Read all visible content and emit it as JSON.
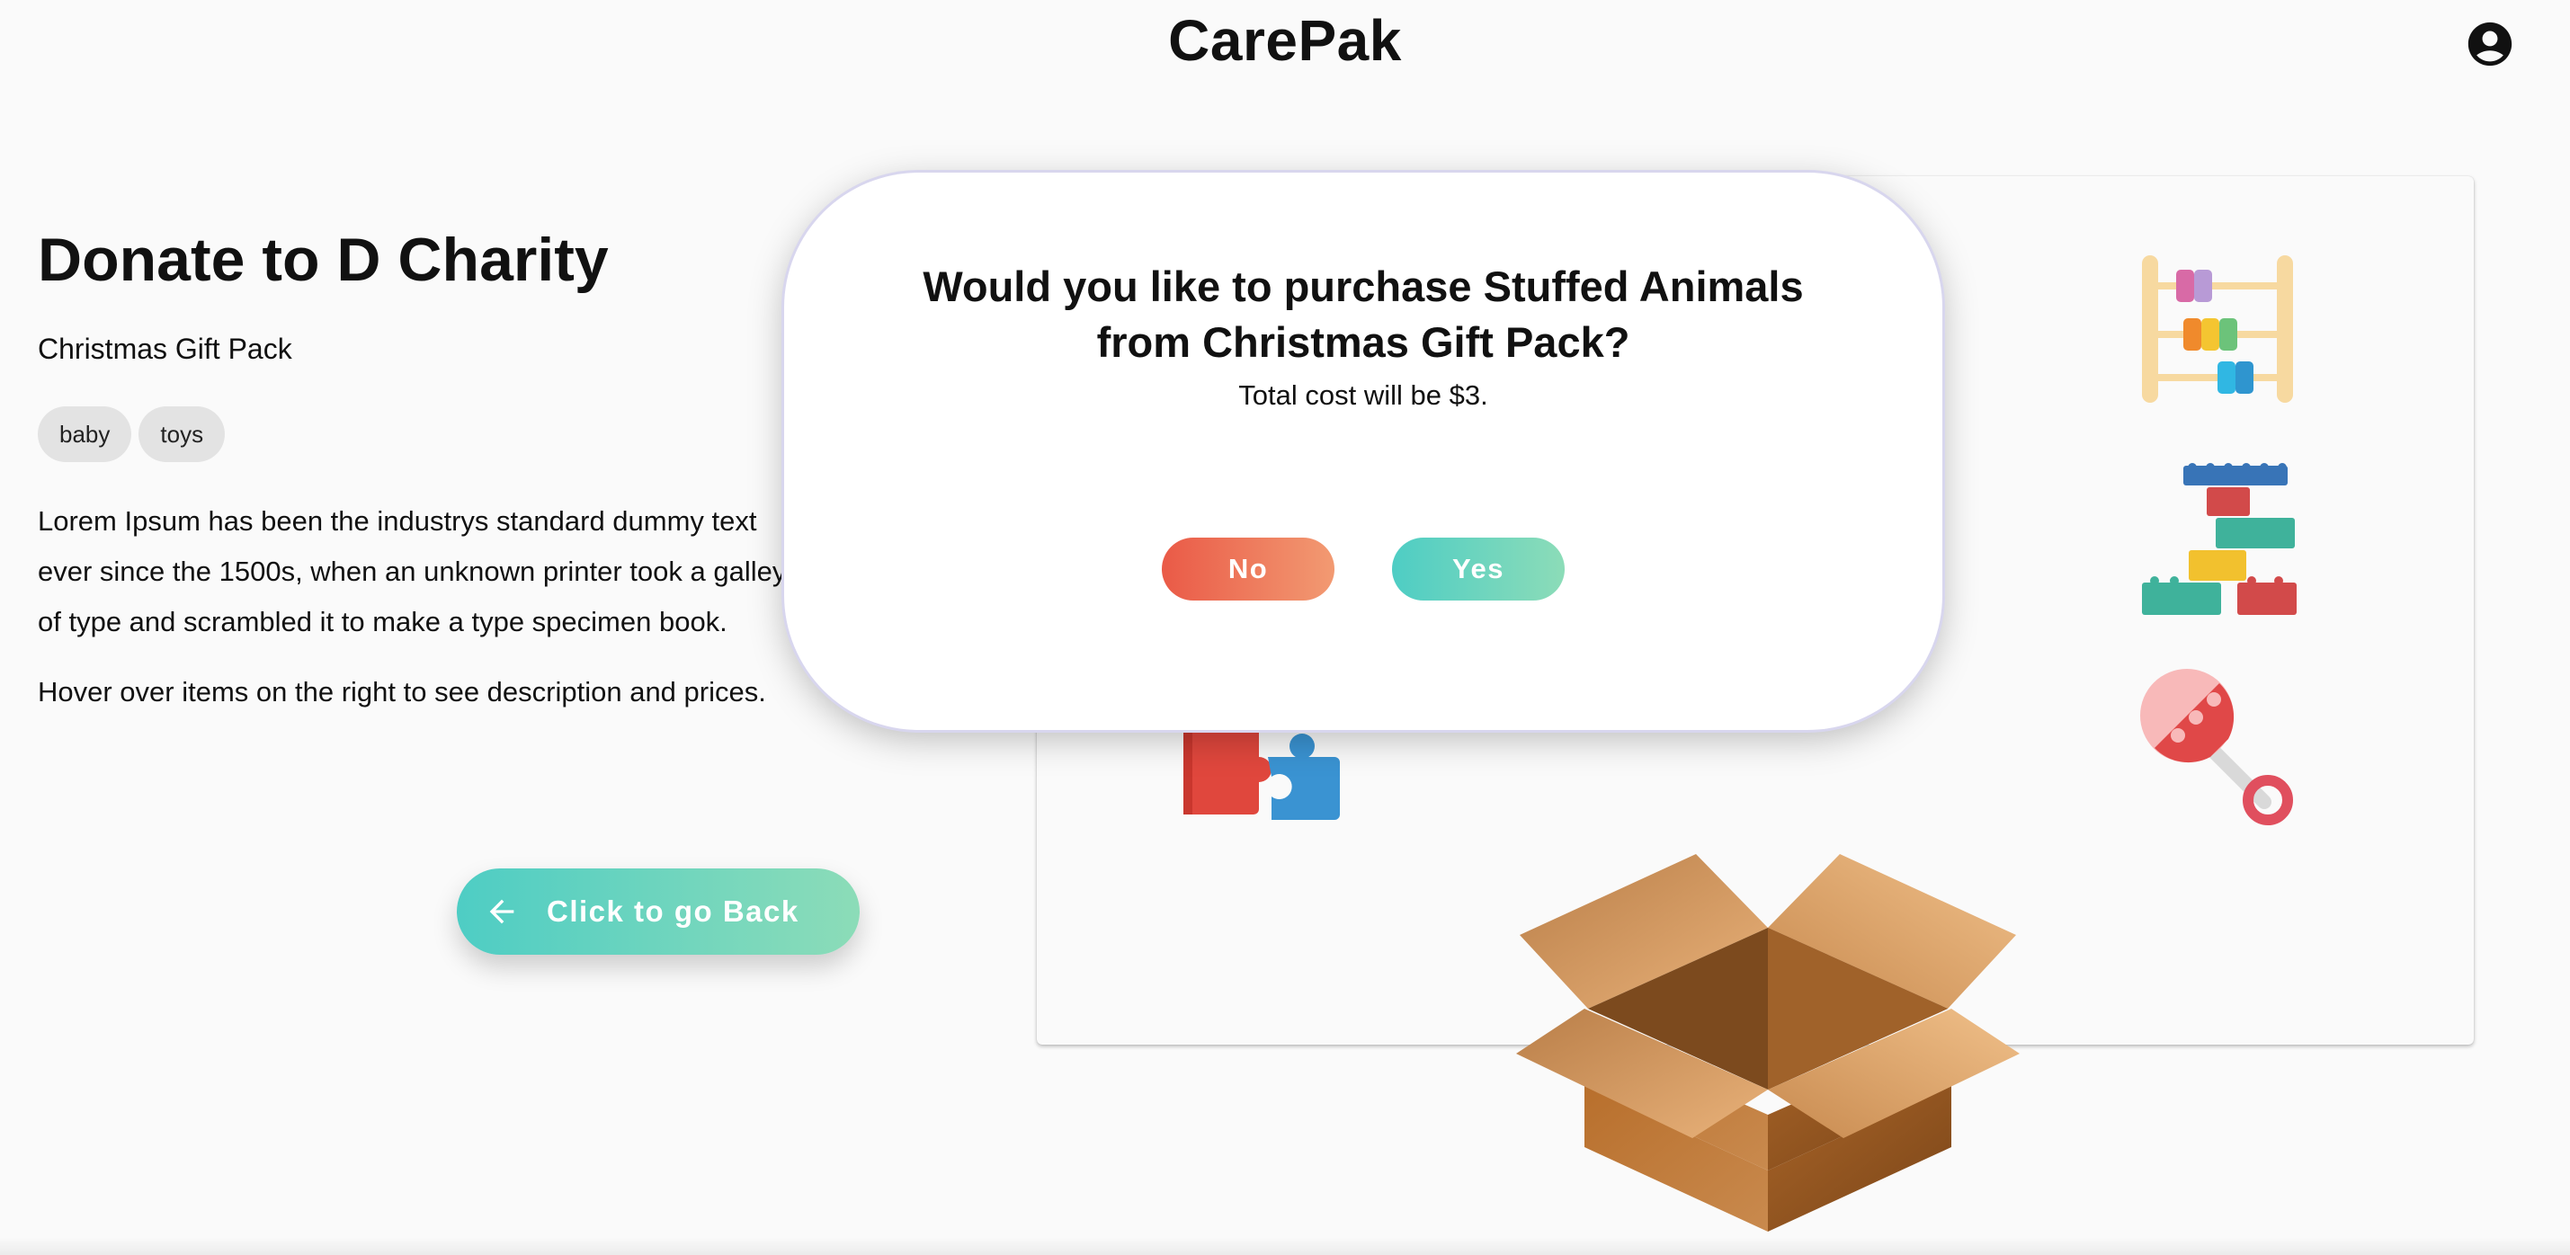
{
  "header": {
    "title": "CarePak",
    "account_icon": "account-circle-icon"
  },
  "main": {
    "title": "Donate to D Charity",
    "subtitle": "Christmas Gift Pack",
    "tags": [
      "baby",
      "toys"
    ],
    "description": "Lorem Ipsum has been the industrys standard dummy text ever since the 1500s, when an unknown printer took a galley of type and scrambled it to make a type specimen book.",
    "hint": "Hover over items on the right to see description and prices.",
    "back_button": {
      "label": "Click to go Back",
      "icon": "arrow-left-icon"
    }
  },
  "items_panel": {
    "items": [
      "abacus-icon",
      "building-blocks-icon",
      "puzzle-pieces-icon",
      "baby-rattle-icon"
    ],
    "box": "cardboard-box-icon"
  },
  "modal": {
    "question": "Would you like to purchase Stuffed Animals from Christmas Gift Pack?",
    "cost_text": "Total cost will be $3.",
    "no_label": "No",
    "yes_label": "Yes"
  },
  "colors": {
    "teal_start": "#4ecdc4",
    "teal_end": "#8cdcb8",
    "red_start": "#ea5a47",
    "red_end": "#f29a72"
  }
}
